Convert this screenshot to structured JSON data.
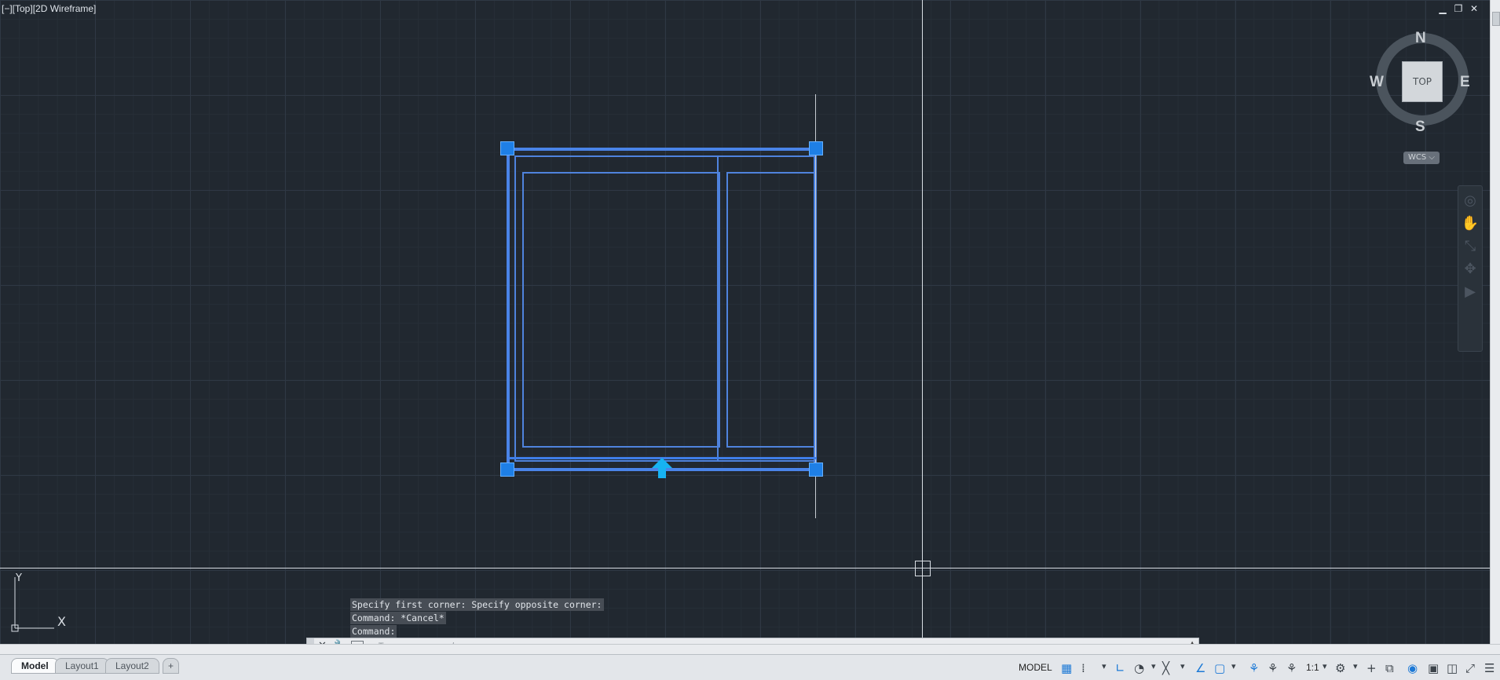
{
  "viewport": {
    "label": "[−][Top][2D Wireframe]"
  },
  "window_controls": {
    "minimize": "▁",
    "restore": "❐",
    "close": "✕"
  },
  "viewcube": {
    "top_face": "TOP",
    "north": "N",
    "south": "S",
    "east": "E",
    "west": "W",
    "wcs": "WCS ⌵"
  },
  "ucs": {
    "x": "X",
    "y": "Y"
  },
  "command_history": [
    "Specify first corner: Specify opposite corner:",
    "Command: *Cancel*",
    "Command:"
  ],
  "command_line": {
    "placeholder": "Type a command"
  },
  "layout_tabs": [
    "Model",
    "Layout1",
    "Layout2"
  ],
  "add_tab": "+",
  "status": {
    "model": "MODEL",
    "scale": "1:1"
  },
  "icons": {
    "grid": "grid-icon",
    "snap": "snap-icon",
    "ortho": "ortho-icon",
    "polar": "polar-icon",
    "osnap": "osnap-icon",
    "annot": "annotation-icon",
    "settings": "gear-icon"
  }
}
